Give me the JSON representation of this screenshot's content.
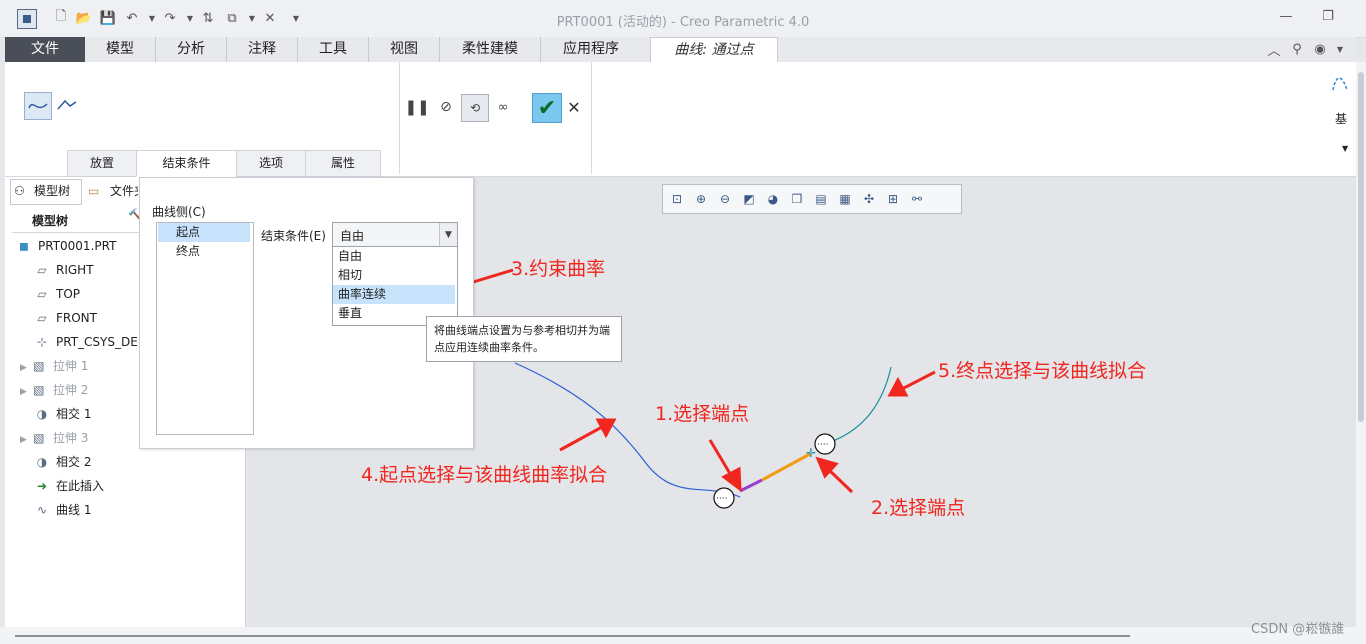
{
  "window": {
    "title": "PRT0001 (活动的) - Creo Parametric 4.0"
  },
  "ribbon": {
    "tabs": [
      "文件",
      "模型",
      "分析",
      "注释",
      "工具",
      "视图",
      "柔性建模",
      "应用程序"
    ],
    "active_tab": "曲线: 通过点",
    "subtabs": [
      "放置",
      "结束条件",
      "选项",
      "属性"
    ],
    "right_label": "基"
  },
  "left_panel": {
    "tabs": [
      "模型树",
      "文件夹"
    ],
    "header": "模型树",
    "tree": [
      {
        "label": "PRT0001.PRT",
        "icon": "part-icon"
      },
      {
        "label": "RIGHT",
        "icon": "datum-plane-icon"
      },
      {
        "label": "TOP",
        "icon": "datum-plane-icon"
      },
      {
        "label": "FRONT",
        "icon": "datum-plane-icon"
      },
      {
        "label": "PRT_CSYS_DEF",
        "icon": "csys-icon"
      },
      {
        "label": "拉伸 1",
        "icon": "extrude-icon"
      },
      {
        "label": "拉伸 2",
        "icon": "extrude-icon"
      },
      {
        "label": "相交 1",
        "icon": "intersect-icon"
      },
      {
        "label": "拉伸 3",
        "icon": "extrude-icon"
      },
      {
        "label": "相交 2",
        "icon": "intersect-icon"
      },
      {
        "label": "在此插入",
        "icon": "insert-arrow-icon"
      },
      {
        "label": "曲线 1",
        "icon": "curve-icon"
      }
    ]
  },
  "end_conditions_panel": {
    "curve_side_label": "曲线侧(C)",
    "sides": [
      "起点",
      "终点"
    ],
    "condition_label": "结束条件(E)",
    "condition_value": "自由",
    "options": [
      "自由",
      "相切",
      "曲率连续",
      "垂直"
    ],
    "tooltip": "将曲线端点设置为与参考相切并为端点应用连续曲率条件。"
  },
  "annotations": {
    "a1": "1.选择端点",
    "a2": "2.选择端点",
    "a3": "3.约束曲率",
    "a4": "4.起点选择与该曲线曲率拟合",
    "a5": "5.终点选择与该曲线拟合"
  },
  "watermark": "CSDN @崧镞誰",
  "colors": {
    "annotation": "#f0261f",
    "accent": "#2f86d6",
    "file_tab": "#4a4f57"
  }
}
